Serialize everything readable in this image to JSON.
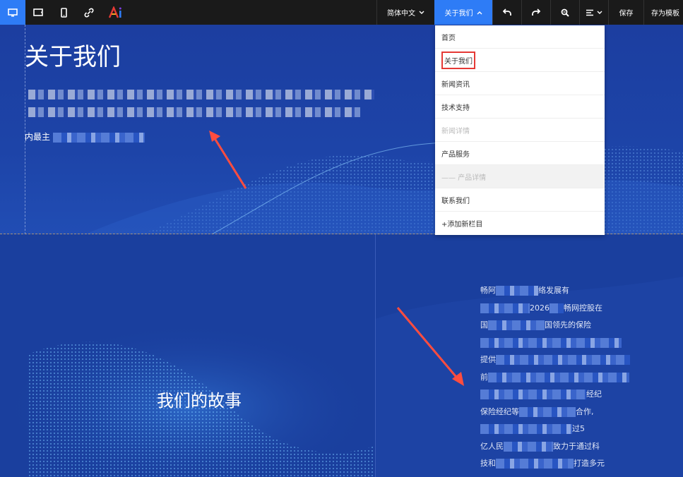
{
  "toolbar": {
    "device_icons": [
      "desktop-icon",
      "tablet-landscape-icon",
      "mobile-icon",
      "link-icon",
      "ai-logo-icon"
    ],
    "language_label": "简体中文",
    "column_label": "关于我们",
    "undo_icon": "undo-icon",
    "redo_icon": "redo-icon",
    "zoom_icon": "zoom-icon",
    "align_icon": "align-icon",
    "save_label": "保存",
    "save_template_label": "存为模板"
  },
  "colors": {
    "toolbar_bg": "#1a1a1a",
    "accent": "#2e7cf6",
    "canvas_bg": "#1b3e9c",
    "highlight_border": "#e53935",
    "arrow": "#ff4d3f"
  },
  "hero": {
    "title": "关于我们",
    "small_text": "内最主"
  },
  "story": {
    "title": "我们的故事",
    "lines": [
      {
        "prefix": "畅阿",
        "suffix": "络发展有"
      },
      {
        "prefix": "",
        "suffix": "2026",
        "tail": "畅网控股在"
      },
      {
        "prefix": "国",
        "suffix": "国领先的保险"
      },
      {
        "prefix": "",
        "suffix": ""
      },
      {
        "prefix": "提供",
        "suffix": ""
      },
      {
        "prefix": "前",
        "suffix": ""
      },
      {
        "prefix": "",
        "suffix": "经纪"
      },
      {
        "prefix": "保险经纪等",
        "suffix": "合作,"
      },
      {
        "prefix": "",
        "suffix": "过5"
      },
      {
        "prefix": "亿人民",
        "suffix": "致力于通过科"
      },
      {
        "prefix": "技和",
        "suffix": "打造多元"
      }
    ]
  },
  "dropdown": {
    "items": [
      {
        "label": "首页",
        "state": "normal"
      },
      {
        "label": "关于我们",
        "state": "highlight"
      },
      {
        "label": "新闻资讯",
        "state": "normal"
      },
      {
        "label": "技术支持",
        "state": "normal"
      },
      {
        "label": "新闻详情",
        "state": "disabled"
      },
      {
        "label": "产品服务",
        "state": "normal"
      },
      {
        "label": "—— 产品详情",
        "state": "sub"
      },
      {
        "label": "联系我们",
        "state": "normal"
      },
      {
        "label": "+添加新栏目",
        "state": "add"
      }
    ]
  }
}
